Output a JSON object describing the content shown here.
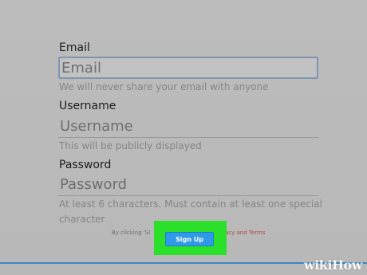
{
  "form": {
    "email": {
      "label": "Email",
      "placeholder": "Email",
      "hint": "We will never share your email with anyone"
    },
    "username": {
      "label": "Username",
      "placeholder": "Username",
      "hint": "This will be publicly displayed"
    },
    "password": {
      "label": "Password",
      "placeholder": "Password",
      "hint": "At least 6 characters. Must contain at least one special character"
    },
    "submit_label": "Sign Up"
  },
  "footer": {
    "text": "By clicking 'Si",
    "link_text": "acy and Terms"
  },
  "watermark": "wikiHow",
  "colors": {
    "highlight": "#2be02b",
    "button": "#2f9be8",
    "accent_rule": "#3b88c6"
  }
}
